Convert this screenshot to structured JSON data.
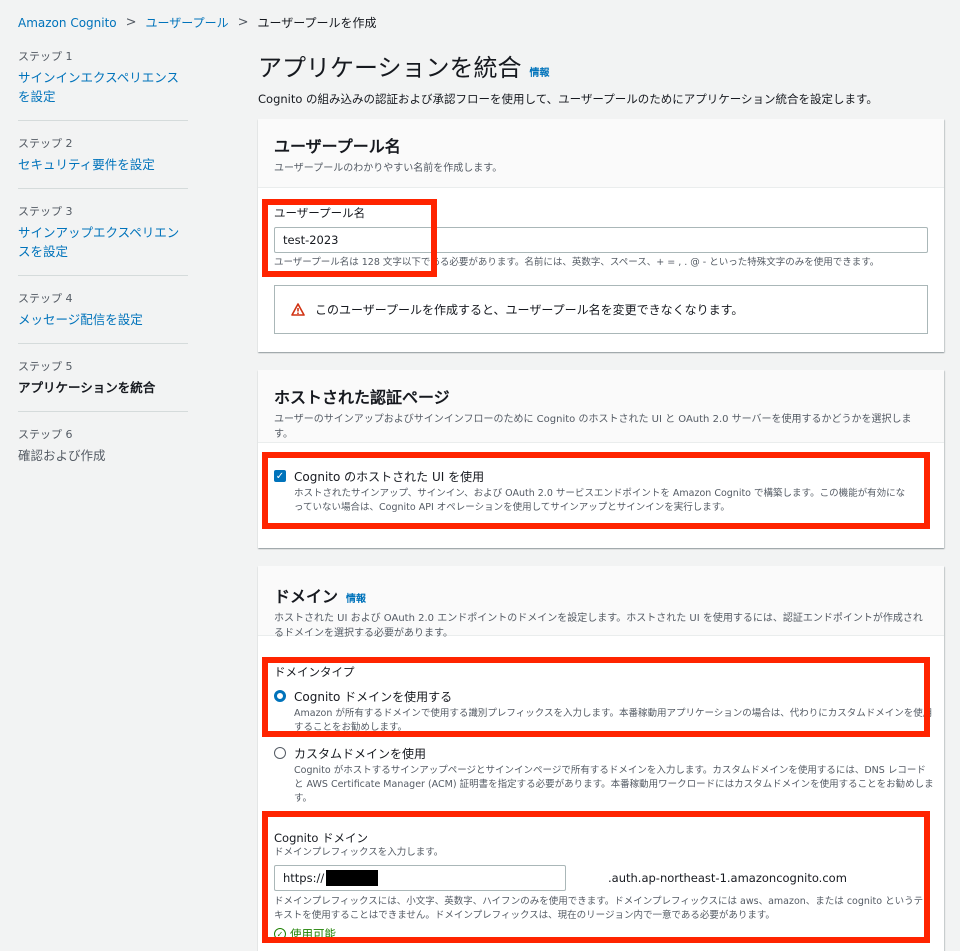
{
  "breadcrumb": {
    "items": [
      "Amazon Cognito",
      "ユーザープール",
      "ユーザープールを作成"
    ],
    "separator": ">"
  },
  "steps": [
    {
      "number": "ステップ 1",
      "title": "サインインエクスペリエンスを設定"
    },
    {
      "number": "ステップ 2",
      "title": "セキュリティ要件を設定"
    },
    {
      "number": "ステップ 3",
      "title": "サインアップエクスペリエンスを設定"
    },
    {
      "number": "ステップ 4",
      "title": "メッセージ配信を設定"
    },
    {
      "number": "ステップ 5",
      "title": "アプリケーションを統合"
    },
    {
      "number": "ステップ 6",
      "title": "確認および作成"
    }
  ],
  "page": {
    "title": "アプリケーションを統合",
    "info": "情報",
    "description": "Cognito の組み込みの認証および承認フローを使用して、ユーザープールのためにアプリケーション統合を設定します。"
  },
  "pool_name_panel": {
    "title": "ユーザープール名",
    "description": "ユーザープールのわかりやすい名前を作成します。",
    "field_label": "ユーザープール名",
    "field_value": "test-2023",
    "field_hint": "ユーザープール名は 128 文字以下である必要があります。名前には、英数字、スペース、+ = , . @ - といった特殊文字のみを使用できます。",
    "alert": "このユーザープールを作成すると、ユーザープール名を変更できなくなります。"
  },
  "hosted_ui_panel": {
    "title": "ホストされた認証ページ",
    "description": "ユーザーのサインアップおよびサインインフローのために Cognito のホストされた UI と OAuth 2.0 サーバーを使用するかどうかを選択します。",
    "checkbox_label": "Cognito のホストされた UI を使用",
    "checkbox_checked": true,
    "checkbox_hint": "ホストされたサインアップ、サインイン、および OAuth 2.0 サービスエンドポイントを Amazon Cognito で構築します。この機能が有効になっていない場合は、Cognito API オペレーションを使用してサインアップとサインインを実行します。"
  },
  "domain_panel": {
    "title": "ドメイン",
    "info": "情報",
    "description": "ホストされた UI および OAuth 2.0 エンドポイントのドメインを設定します。ホストされた UI を使用するには、認証エンドポイントが作成されるドメインを選択する必要があります。",
    "type_label": "ドメインタイプ",
    "options": [
      {
        "label": "Cognito ドメインを使用する",
        "hint": "Amazon が所有するドメインで使用する識別プレフィックスを入力します。本番稼動用アプリケーションの場合は、代わりにカスタムドメインを使用することをお勧めします。",
        "selected": true
      },
      {
        "label": "カスタムドメインを使用",
        "hint": "Cognito がホストするサインアップページとサインインページで所有するドメインを入力します。カスタムドメインを使用するには、DNS レコードと AWS Certificate Manager (ACM) 証明書を指定する必要があります。本番稼動用ワークロードにはカスタムドメインを使用することをお勧めします。",
        "selected": false
      }
    ],
    "cognito_domain_label": "Cognito ドメイン",
    "cognito_domain_sub": "ドメインプレフィックスを入力します。",
    "prefix_value": "https://",
    "domain_suffix": ".auth.ap-northeast-1.amazoncognito.com",
    "domain_hint": "ドメインプレフィックスには、小文字、英数字、ハイフンのみを使用できます。ドメインプレフィックスには aws、amazon、または cognito というテキストを使用することはできません。ドメインプレフィックスは、現在のリージョン内で一意である必要があります。",
    "availability": "使用可能"
  },
  "colors": {
    "link": "#0073bb",
    "highlight": "#ff2400",
    "success": "#1d8102",
    "warning": "#d13212"
  }
}
